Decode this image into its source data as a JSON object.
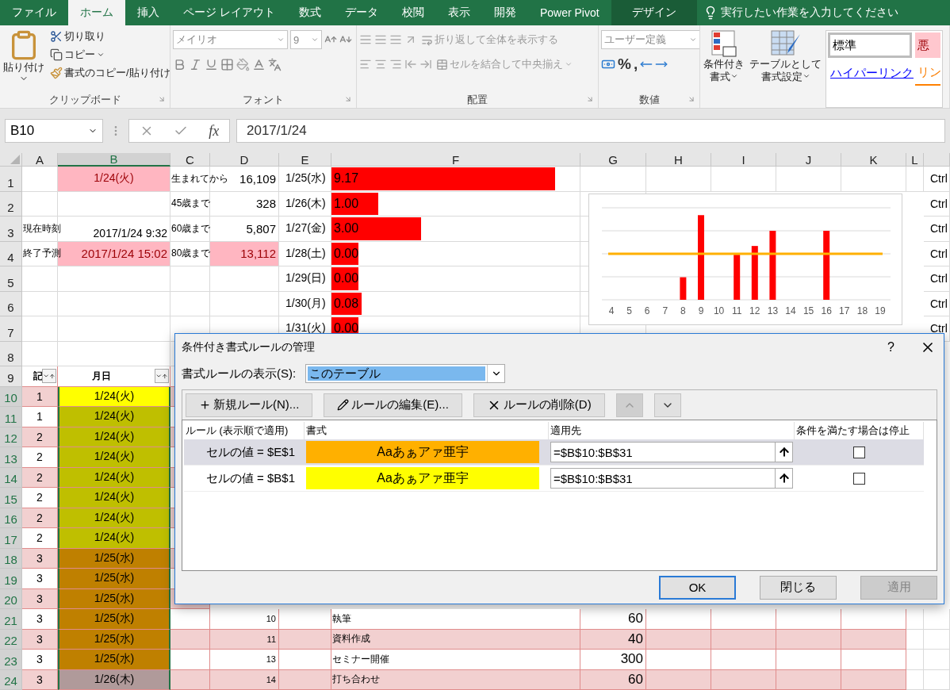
{
  "ribbon_tabs": [
    {
      "label": "ファイル",
      "selected": false,
      "kind": "normal"
    },
    {
      "label": "ホーム",
      "selected": true,
      "kind": "normal"
    },
    {
      "label": "挿入",
      "selected": false,
      "kind": "normal"
    },
    {
      "label": "ページ レイアウト",
      "selected": false,
      "kind": "normal"
    },
    {
      "label": "数式",
      "selected": false,
      "kind": "normal"
    },
    {
      "label": "データ",
      "selected": false,
      "kind": "normal"
    },
    {
      "label": "校閲",
      "selected": false,
      "kind": "normal"
    },
    {
      "label": "表示",
      "selected": false,
      "kind": "normal"
    },
    {
      "label": "開発",
      "selected": false,
      "kind": "normal"
    },
    {
      "label": "Power Pivot",
      "selected": false,
      "kind": "normal"
    },
    {
      "label": "デザイン",
      "selected": false,
      "kind": "contextual"
    }
  ],
  "tell_me": "実行したい作業を入力してください",
  "clipboard": {
    "paste": "貼り付け",
    "cut": "切り取り",
    "copy": "コピー",
    "format_painter": "書式のコピー/貼り付け",
    "label": "クリップボード"
  },
  "font": {
    "name": "メイリオ",
    "size": "9",
    "label": "フォント"
  },
  "alignment": {
    "wrap": "折り返して全体を表示する",
    "merge": "セルを結合して中央揃え",
    "label": "配置"
  },
  "number": {
    "format": "ユーザー定義",
    "percent": "%",
    "comma": ",",
    "label": "数値"
  },
  "styles": {
    "conditional": [
      "条件付き",
      "書式"
    ],
    "table": [
      "テーブルとして",
      "書式設定"
    ],
    "cell_styles": [
      {
        "text": "標準",
        "kind": "normal"
      },
      {
        "text": "悪",
        "kind": "bad"
      },
      {
        "text": "ハイパーリンク",
        "kind": "hyperlink"
      },
      {
        "text": "リン",
        "kind": "linked"
      }
    ]
  },
  "formula_bar": {
    "name_box": "B10",
    "fx": "fx",
    "formula": "2017/1/24"
  },
  "columns": [
    {
      "label": "A",
      "selected": false
    },
    {
      "label": "B",
      "selected": true
    },
    {
      "label": "C",
      "selected": false
    },
    {
      "label": "D",
      "selected": false
    },
    {
      "label": "E",
      "selected": false
    },
    {
      "label": "F",
      "selected": false
    },
    {
      "label": "G",
      "selected": false
    },
    {
      "label": "H",
      "selected": false
    },
    {
      "label": "I",
      "selected": false
    },
    {
      "label": "J",
      "selected": false
    },
    {
      "label": "K",
      "selected": false
    },
    {
      "label": "L",
      "selected": false
    }
  ],
  "rows": [
    {
      "header": "1",
      "selected": false,
      "kind": "plain",
      "cells": {
        "B": {
          "text": "1/24(火)",
          "kind": "center",
          "highlighted": true
        },
        "C": {
          "text": "生まれてから",
          "kind": "label"
        },
        "D": {
          "text": "16,109",
          "kind": "right"
        },
        "E": {
          "text": "1/25(水)",
          "kind": "date"
        },
        "F": {
          "text": "9.17",
          "kind": "databar",
          "level": 0.9
        },
        "M": {
          "text": "Ctrl",
          "kind": "date"
        }
      }
    },
    {
      "header": "2",
      "selected": false,
      "kind": "plain",
      "cells": {
        "C": {
          "text": "45歳まで",
          "kind": "label"
        },
        "D": {
          "text": "328",
          "kind": "right"
        },
        "E": {
          "text": "1/26(木)",
          "kind": "date"
        },
        "F": {
          "text": "1.00",
          "kind": "databar",
          "level": 0.19
        },
        "M": {
          "text": "Ctrl",
          "kind": "date"
        }
      }
    },
    {
      "header": "3",
      "selected": false,
      "kind": "plain",
      "cells": {
        "A": {
          "text": "現在時刻",
          "kind": "label"
        },
        "B": {
          "text": "2017/1/24 9:32",
          "kind": "bottomright"
        },
        "C": {
          "text": "60歳まで",
          "kind": "label"
        },
        "D": {
          "text": "5,807",
          "kind": "right"
        },
        "E": {
          "text": "1/27(金)",
          "kind": "date"
        },
        "F": {
          "text": "3.00",
          "kind": "databar",
          "level": 0.36
        },
        "M": {
          "text": "Ctrl",
          "kind": "date"
        }
      }
    },
    {
      "header": "4",
      "selected": false,
      "kind": "plain",
      "cells": {
        "A": {
          "text": "終了予測",
          "kind": "label"
        },
        "B": {
          "text": "2017/1/24 15:02",
          "kind": "right",
          "highlighted": true
        },
        "C": {
          "text": "80歳まで",
          "kind": "label"
        },
        "D": {
          "text": "13,112",
          "kind": "right",
          "highlighted": true
        },
        "E": {
          "text": "1/28(土)",
          "kind": "date"
        },
        "F": {
          "text": "0.00",
          "kind": "databar",
          "level": 0.11
        },
        "M": {
          "text": "Ctrl",
          "kind": "date"
        }
      }
    },
    {
      "header": "5",
      "selected": false,
      "kind": "plain",
      "cells": {
        "E": {
          "text": "1/29(日)",
          "kind": "date"
        },
        "F": {
          "text": "0.00",
          "kind": "databar",
          "level": 0.11
        },
        "M": {
          "text": "Ctrl",
          "kind": "date"
        }
      }
    },
    {
      "header": "6",
      "selected": false,
      "kind": "plain",
      "cells": {
        "E": {
          "text": "1/30(月)",
          "kind": "date"
        },
        "F": {
          "text": "0.08",
          "kind": "databar",
          "level": 0.12
        },
        "M": {
          "text": "Ctrl",
          "kind": "date"
        }
      }
    },
    {
      "header": "7",
      "selected": false,
      "kind": "plain",
      "cells": {
        "E": {
          "text": "1/31(火)",
          "kind": "date"
        },
        "F": {
          "text": "0.00",
          "kind": "databar",
          "level": 0.11
        },
        "M": {
          "text": "Ctrl",
          "kind": "date"
        }
      }
    },
    {
      "header": "8",
      "selected": false,
      "kind": "plain",
      "cells": {}
    },
    {
      "header": "9",
      "selected": false,
      "kind": "table",
      "banded": false,
      "cells": {
        "A": {
          "text": "記",
          "kind": "header"
        },
        "B": {
          "text": "月日",
          "kind": "header"
        }
      }
    },
    {
      "header": "10",
      "selected": true,
      "kind": "table",
      "banded": true,
      "cells": {
        "A": {
          "text": "1",
          "kind": "center"
        },
        "B": {
          "text": "1/24(火)",
          "kind": "center",
          "color": "#ffff00"
        }
      }
    },
    {
      "header": "11",
      "selected": true,
      "kind": "table",
      "banded": false,
      "cells": {
        "A": {
          "text": "1",
          "kind": "center"
        },
        "B": {
          "text": "1/24(火)",
          "kind": "center",
          "color": "#bfbf00"
        }
      }
    },
    {
      "header": "12",
      "selected": true,
      "kind": "table",
      "banded": true,
      "cells": {
        "A": {
          "text": "2",
          "kind": "center"
        },
        "B": {
          "text": "1/24(火)",
          "kind": "center",
          "color": "#bfbf00"
        }
      }
    },
    {
      "header": "13",
      "selected": true,
      "kind": "table",
      "banded": false,
      "cells": {
        "A": {
          "text": "2",
          "kind": "center"
        },
        "B": {
          "text": "1/24(火)",
          "kind": "center",
          "color": "#bfbf00"
        }
      }
    },
    {
      "header": "14",
      "selected": true,
      "kind": "table",
      "banded": true,
      "cells": {
        "A": {
          "text": "2",
          "kind": "center"
        },
        "B": {
          "text": "1/24(火)",
          "kind": "center",
          "color": "#bfbf00"
        }
      }
    },
    {
      "header": "15",
      "selected": true,
      "kind": "table",
      "banded": false,
      "cells": {
        "A": {
          "text": "2",
          "kind": "center"
        },
        "B": {
          "text": "1/24(火)",
          "kind": "center",
          "color": "#bfbf00"
        }
      }
    },
    {
      "header": "16",
      "selected": true,
      "kind": "table",
      "banded": true,
      "cells": {
        "A": {
          "text": "2",
          "kind": "center"
        },
        "B": {
          "text": "1/24(火)",
          "kind": "center",
          "color": "#bfbf00"
        }
      }
    },
    {
      "header": "17",
      "selected": true,
      "kind": "table",
      "banded": false,
      "cells": {
        "A": {
          "text": "2",
          "kind": "center"
        },
        "B": {
          "text": "1/24(火)",
          "kind": "center",
          "color": "#bfbf00"
        }
      }
    },
    {
      "header": "18",
      "selected": true,
      "kind": "table",
      "banded": true,
      "cells": {
        "A": {
          "text": "3",
          "kind": "center"
        },
        "B": {
          "text": "1/25(水)",
          "kind": "center",
          "color": "#bf8000"
        }
      }
    },
    {
      "header": "19",
      "selected": true,
      "kind": "table",
      "banded": false,
      "cells": {
        "A": {
          "text": "3",
          "kind": "center"
        },
        "B": {
          "text": "1/25(水)",
          "kind": "center",
          "color": "#bf8000"
        }
      }
    },
    {
      "header": "20",
      "selected": true,
      "kind": "table",
      "banded": true,
      "cells": {
        "A": {
          "text": "3",
          "kind": "center"
        },
        "B": {
          "text": "1/25(水)",
          "kind": "center",
          "color": "#bf8000"
        }
      }
    },
    {
      "header": "21",
      "selected": true,
      "kind": "table",
      "banded": false,
      "cells": {
        "A": {
          "text": "3",
          "kind": "center"
        },
        "B": {
          "text": "1/25(水)",
          "kind": "center",
          "color": "#bf8000"
        },
        "D": {
          "text": "10",
          "kind": "smallright"
        },
        "F": {
          "text": "執筆",
          "kind": "label"
        },
        "G": {
          "text": "60",
          "kind": "bigright"
        }
      }
    },
    {
      "header": "22",
      "selected": true,
      "kind": "table",
      "banded": true,
      "cells": {
        "A": {
          "text": "3",
          "kind": "center"
        },
        "B": {
          "text": "1/25(水)",
          "kind": "center",
          "color": "#bf8000"
        },
        "D": {
          "text": "11",
          "kind": "smallright"
        },
        "F": {
          "text": "資料作成",
          "kind": "label"
        },
        "G": {
          "text": "40",
          "kind": "bigright"
        }
      }
    },
    {
      "header": "23",
      "selected": true,
      "kind": "table",
      "banded": false,
      "cells": {
        "A": {
          "text": "3",
          "kind": "center"
        },
        "B": {
          "text": "1/25(水)",
          "kind": "center",
          "color": "#bf8000"
        },
        "D": {
          "text": "13",
          "kind": "smallright"
        },
        "F": {
          "text": "セミナー開催",
          "kind": "label"
        },
        "G": {
          "text": "300",
          "kind": "bigright"
        }
      }
    },
    {
      "header": "24",
      "selected": true,
      "kind": "table",
      "banded": true,
      "cells": {
        "A": {
          "text": "3",
          "kind": "center"
        },
        "B": {
          "text": "1/26(木)",
          "kind": "center",
          "color": "#b09a9a"
        },
        "D": {
          "text": "14",
          "kind": "smallright"
        },
        "F": {
          "text": "打ち合わせ",
          "kind": "label"
        },
        "G": {
          "text": "60",
          "kind": "bigright"
        }
      }
    }
  ],
  "chart": {
    "x_labels": [
      "4",
      "5",
      "6",
      "7",
      "8",
      "9",
      "10",
      "11",
      "12",
      "13",
      "14",
      "15",
      "16",
      "17",
      "18",
      "19"
    ]
  },
  "dialog": {
    "title": "条件付き書式ルールの管理",
    "help": "?",
    "show_label": "書式ルールの表示(S):",
    "show_value": "このテーブル",
    "toolbar": [
      {
        "label": "新規ルール(N)...",
        "kind": "new"
      },
      {
        "label": "ルールの編集(E)...",
        "kind": "edit"
      },
      {
        "label": "ルールの削除(D)",
        "kind": "delete"
      }
    ],
    "move_up": {
      "disabled": true
    },
    "move_down": {
      "disabled": false
    },
    "columns": [
      "ルール (表示順で適用)",
      "書式",
      "適用先",
      "条件を満たす場合は停止"
    ],
    "rules": [
      {
        "rule": "セルの値 = $E$1",
        "preview": "Aaあぁアァ亜宇",
        "color": "#ffb000",
        "applies_to": "=$B$10:$B$31",
        "stop": false,
        "selected": true
      },
      {
        "rule": "セルの値 = $B$1",
        "preview": "Aaあぁアァ亜宇",
        "color": "#ffff00",
        "applies_to": "=$B$10:$B$31",
        "stop": false,
        "selected": false
      }
    ],
    "buttons": [
      {
        "label": "OK",
        "kind": "default",
        "disabled": false
      },
      {
        "label": "閉じる",
        "kind": "normal",
        "disabled": false
      },
      {
        "label": "適用",
        "kind": "normal",
        "disabled": true
      }
    ]
  }
}
